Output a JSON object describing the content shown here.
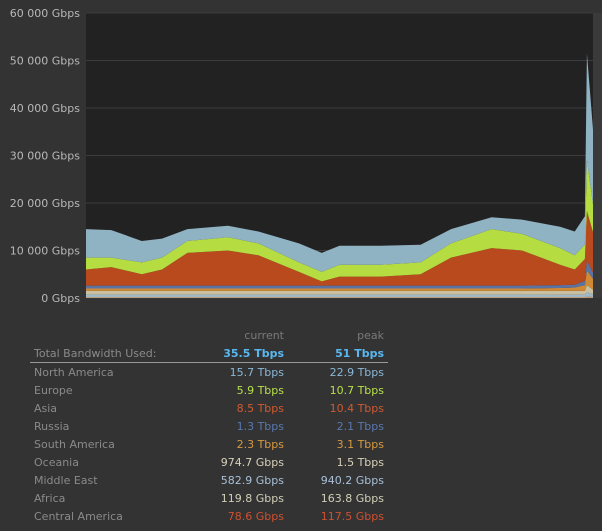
{
  "chart_data": {
    "type": "area",
    "stacked": true,
    "title": "",
    "xlabel": "",
    "ylabel": "",
    "ylim": [
      0,
      60000
    ],
    "yticks": [
      "0 Gbps",
      "10 000 Gbps",
      "20 000 Gbps",
      "30 000 Gbps",
      "40 000 Gbps",
      "50 000 Gbps",
      "60 000 Gbps"
    ],
    "ytick_values": [
      0,
      10000,
      20000,
      30000,
      40000,
      50000,
      60000
    ],
    "grid": true,
    "x": [
      0,
      5,
      11,
      15,
      20,
      28,
      34,
      42,
      46.5,
      50,
      58,
      66,
      72,
      80,
      86,
      93.5,
      96.4,
      98.4,
      98.8,
      100
    ],
    "series": [
      {
        "name": "Central America",
        "color": "#c0502a",
        "values": [
          80,
          80,
          80,
          80,
          80,
          80,
          80,
          80,
          80,
          80,
          80,
          80,
          80,
          80,
          80,
          80,
          80,
          80,
          117,
          79
        ]
      },
      {
        "name": "Africa",
        "color": "#cfcca4",
        "values": [
          120,
          120,
          120,
          120,
          120,
          120,
          120,
          120,
          120,
          120,
          120,
          120,
          120,
          120,
          120,
          120,
          120,
          120,
          164,
          120
        ]
      },
      {
        "name": "Middle East",
        "color": "#9fb8c8",
        "values": [
          500,
          500,
          500,
          500,
          500,
          500,
          500,
          500,
          500,
          500,
          500,
          500,
          500,
          500,
          500,
          500,
          500,
          500,
          940,
          583
        ]
      },
      {
        "name": "Oceania",
        "color": "#c8c0a0",
        "values": [
          800,
          800,
          800,
          800,
          800,
          800,
          800,
          800,
          800,
          800,
          800,
          800,
          800,
          800,
          800,
          800,
          800,
          800,
          1500,
          975
        ]
      },
      {
        "name": "South America",
        "color": "#d08a35",
        "values": [
          500,
          500,
          500,
          500,
          500,
          500,
          500,
          500,
          500,
          500,
          500,
          500,
          500,
          500,
          500,
          600,
          700,
          1200,
          3100,
          2300
        ]
      },
      {
        "name": "Russia",
        "color": "#5a73a3",
        "values": [
          600,
          600,
          600,
          600,
          600,
          600,
          600,
          600,
          600,
          600,
          600,
          600,
          600,
          600,
          600,
          600,
          600,
          900,
          2100,
          1300
        ]
      },
      {
        "name": "Asia",
        "color": "#b84a1e",
        "values": [
          3400,
          3900,
          2400,
          3400,
          6900,
          7400,
          6400,
          2900,
          900,
          1900,
          1900,
          2400,
          5900,
          7900,
          7400,
          4300,
          3200,
          4600,
          10400,
          8500
        ]
      },
      {
        "name": "Europe",
        "color": "#b5dc41",
        "values": [
          2500,
          2000,
          2500,
          2500,
          2500,
          2800,
          2500,
          2000,
          2000,
          2500,
          2500,
          2500,
          3000,
          4000,
          3500,
          3500,
          3000,
          3000,
          10700,
          5900
        ]
      },
      {
        "name": "North America",
        "color": "#8fb3c3",
        "values": [
          6000,
          5800,
          4500,
          4000,
          2500,
          2400,
          2500,
          4000,
          4000,
          4000,
          4000,
          3700,
          3000,
          2500,
          3000,
          4500,
          5000,
          6000,
          22500,
          15700
        ]
      }
    ]
  },
  "table": {
    "header_current": "current",
    "header_peak": "peak",
    "total": {
      "label": "Total Bandwidth Used:",
      "current": "35.5 Tbps",
      "peak": "51 Tbps",
      "color": "#5ab8f0"
    },
    "rows": [
      {
        "label": "North America",
        "current": "15.7 Tbps",
        "peak": "22.9 Tbps",
        "color": "#8ab8d8"
      },
      {
        "label": "Europe",
        "current": "5.9 Tbps",
        "peak": "10.7 Tbps",
        "color": "#b8e04a"
      },
      {
        "label": "Asia",
        "current": "8.5 Tbps",
        "peak": "10.4 Tbps",
        "color": "#d05a30"
      },
      {
        "label": "Russia",
        "current": "1.3 Tbps",
        "peak": "2.1 Tbps",
        "color": "#5878b0"
      },
      {
        "label": "South America",
        "current": "2.3 Tbps",
        "peak": "3.1 Tbps",
        "color": "#d89a40"
      },
      {
        "label": "Oceania",
        "current": "974.7 Gbps",
        "peak": "1.5 Tbps",
        "color": "#d8d0b8"
      },
      {
        "label": "Middle East",
        "current": "582.9 Gbps",
        "peak": "940.2 Gbps",
        "color": "#a8c0d8"
      },
      {
        "label": "Africa",
        "current": "119.8 Gbps",
        "peak": "163.8 Gbps",
        "color": "#d0d0b8"
      },
      {
        "label": "Central America",
        "current": "78.6 Gbps",
        "peak": "117.5 Gbps",
        "color": "#d05030"
      }
    ]
  }
}
